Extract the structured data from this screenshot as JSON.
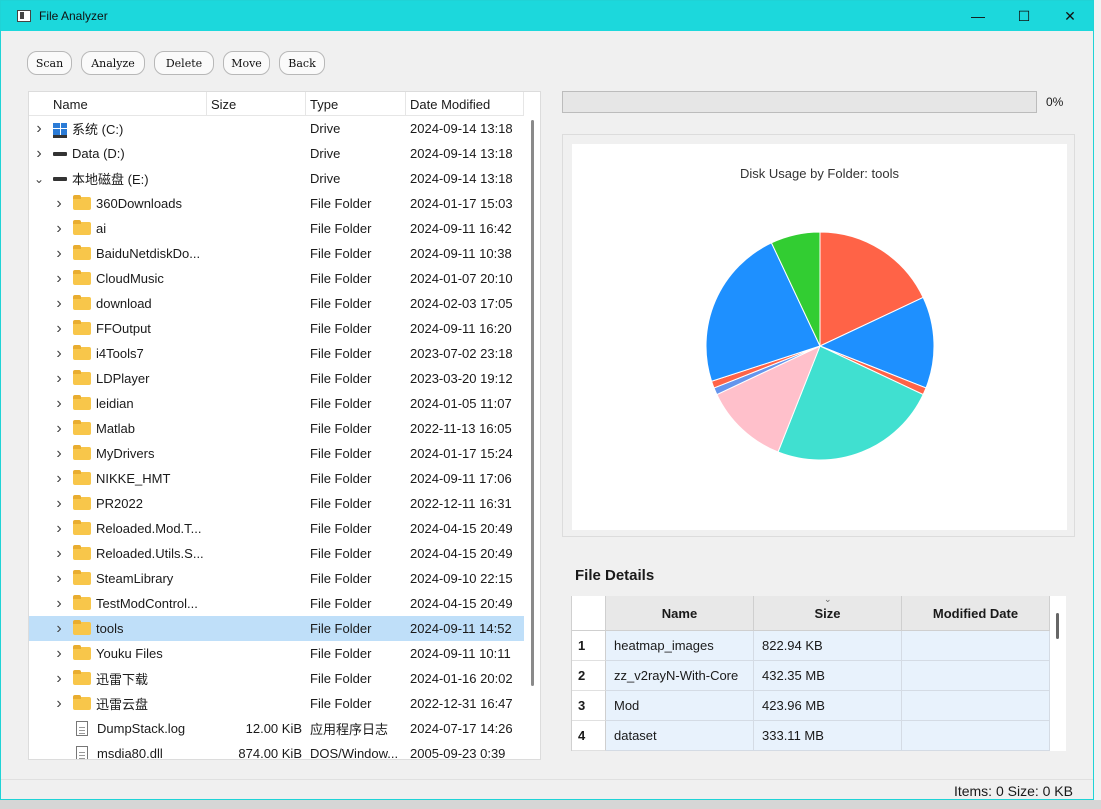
{
  "window": {
    "title": "File Analyzer",
    "minimize": "—",
    "maximize": "☐",
    "close": "✕"
  },
  "toolbar": {
    "scan": "Scan",
    "analyze": "Analyze",
    "delete": "Delete",
    "move": "Move",
    "back": "Back"
  },
  "tree": {
    "headers": {
      "name": "Name",
      "size": "Size",
      "type": "Type",
      "date": "Date Modified"
    },
    "rows": [
      {
        "level": 0,
        "expander": "closed",
        "icon": "system-drive-icon",
        "name": "系统 (C:)",
        "size": "",
        "type": "Drive",
        "date": "2024-09-14 13:18"
      },
      {
        "level": 0,
        "expander": "closed",
        "icon": "drive-icon",
        "name": "Data (D:)",
        "size": "",
        "type": "Drive",
        "date": "2024-09-14 13:18"
      },
      {
        "level": 0,
        "expander": "open",
        "icon": "drive-icon",
        "name": "本地磁盘 (E:)",
        "size": "",
        "type": "Drive",
        "date": "2024-09-14 13:18"
      },
      {
        "level": 1,
        "expander": "closed",
        "icon": "folder-icon",
        "name": "360Downloads",
        "size": "",
        "type": "File Folder",
        "date": "2024-01-17 15:03"
      },
      {
        "level": 1,
        "expander": "closed",
        "icon": "folder-icon",
        "name": "ai",
        "size": "",
        "type": "File Folder",
        "date": "2024-09-11 16:42"
      },
      {
        "level": 1,
        "expander": "closed",
        "icon": "folder-icon",
        "name": "BaiduNetdiskDo...",
        "size": "",
        "type": "File Folder",
        "date": "2024-09-11 10:38"
      },
      {
        "level": 1,
        "expander": "closed",
        "icon": "folder-icon",
        "name": "CloudMusic",
        "size": "",
        "type": "File Folder",
        "date": "2024-01-07 20:10"
      },
      {
        "level": 1,
        "expander": "closed",
        "icon": "folder-icon",
        "name": "download",
        "size": "",
        "type": "File Folder",
        "date": "2024-02-03 17:05"
      },
      {
        "level": 1,
        "expander": "closed",
        "icon": "folder-icon",
        "name": "FFOutput",
        "size": "",
        "type": "File Folder",
        "date": "2024-09-11 16:20"
      },
      {
        "level": 1,
        "expander": "closed",
        "icon": "folder-icon",
        "name": "i4Tools7",
        "size": "",
        "type": "File Folder",
        "date": "2023-07-02 23:18"
      },
      {
        "level": 1,
        "expander": "closed",
        "icon": "folder-icon",
        "name": "LDPlayer",
        "size": "",
        "type": "File Folder",
        "date": "2023-03-20 19:12"
      },
      {
        "level": 1,
        "expander": "closed",
        "icon": "folder-icon",
        "name": "leidian",
        "size": "",
        "type": "File Folder",
        "date": "2024-01-05 11:07"
      },
      {
        "level": 1,
        "expander": "closed",
        "icon": "folder-icon",
        "name": "Matlab",
        "size": "",
        "type": "File Folder",
        "date": "2022-11-13 16:05"
      },
      {
        "level": 1,
        "expander": "closed",
        "icon": "folder-icon",
        "name": "MyDrivers",
        "size": "",
        "type": "File Folder",
        "date": "2024-01-17 15:24"
      },
      {
        "level": 1,
        "expander": "closed",
        "icon": "folder-icon",
        "name": "NIKKE_HMT",
        "size": "",
        "type": "File Folder",
        "date": "2024-09-11 17:06"
      },
      {
        "level": 1,
        "expander": "closed",
        "icon": "folder-icon",
        "name": "PR2022",
        "size": "",
        "type": "File Folder",
        "date": "2022-12-11 16:31"
      },
      {
        "level": 1,
        "expander": "closed",
        "icon": "folder-icon",
        "name": "Reloaded.Mod.T...",
        "size": "",
        "type": "File Folder",
        "date": "2024-04-15 20:49"
      },
      {
        "level": 1,
        "expander": "closed",
        "icon": "folder-icon",
        "name": "Reloaded.Utils.S...",
        "size": "",
        "type": "File Folder",
        "date": "2024-04-15 20:49"
      },
      {
        "level": 1,
        "expander": "closed",
        "icon": "folder-icon",
        "name": "SteamLibrary",
        "size": "",
        "type": "File Folder",
        "date": "2024-09-10 22:15"
      },
      {
        "level": 1,
        "expander": "closed",
        "icon": "folder-icon",
        "name": "TestModControl...",
        "size": "",
        "type": "File Folder",
        "date": "2024-04-15 20:49"
      },
      {
        "level": 1,
        "expander": "closed",
        "icon": "folder-icon",
        "name": "tools",
        "size": "",
        "type": "File Folder",
        "date": "2024-09-11 14:52",
        "selected": true
      },
      {
        "level": 1,
        "expander": "closed",
        "icon": "folder-icon",
        "name": "Youku Files",
        "size": "",
        "type": "File Folder",
        "date": "2024-09-11 10:11"
      },
      {
        "level": 1,
        "expander": "closed",
        "icon": "folder-icon",
        "name": "迅雷下载",
        "size": "",
        "type": "File Folder",
        "date": "2024-01-16 20:02"
      },
      {
        "level": 1,
        "expander": "closed",
        "icon": "folder-icon",
        "name": "迅雷云盘",
        "size": "",
        "type": "File Folder",
        "date": "2022-12-31 16:47"
      },
      {
        "level": 1,
        "expander": "none",
        "icon": "file-icon",
        "name": "DumpStack.log",
        "size": "12.00 KiB",
        "type": "应用程序日志",
        "date": "2024-07-17 14:26"
      },
      {
        "level": 1,
        "expander": "none",
        "icon": "file-icon",
        "name": "msdia80.dll",
        "size": "874.00 KiB",
        "type": "DOS/Window...",
        "date": "2005-09-23 0:39"
      }
    ]
  },
  "progress": {
    "value": 0,
    "text": "0%"
  },
  "chart_data": {
    "type": "pie",
    "title": "Disk Usage by Folder: tools",
    "slices": [
      {
        "value": 18.0,
        "color": "#ff6347"
      },
      {
        "value": 13.0,
        "color": "#1e90ff"
      },
      {
        "value": 1.0,
        "color": "#ff6347"
      },
      {
        "value": 24.0,
        "color": "#40e0d0"
      },
      {
        "value": 12.0,
        "color": "#ffc0cb"
      },
      {
        "value": 1.0,
        "color": "#6495ed"
      },
      {
        "value": 1.0,
        "color": "#ff6347"
      },
      {
        "value": 23.0,
        "color": "#1e90ff"
      },
      {
        "value": 7.0,
        "color": "#32cd32"
      }
    ]
  },
  "details": {
    "title": "File Details",
    "columns": [
      "Name",
      "Size",
      "Modified Date"
    ],
    "rows": [
      {
        "n": "1",
        "name": "heatmap_images",
        "size": "822.94 KB",
        "date": ""
      },
      {
        "n": "2",
        "name": "zz_v2rayN-With-Core",
        "size": "432.35 MB",
        "date": ""
      },
      {
        "n": "3",
        "name": "Mod",
        "size": "423.96 MB",
        "date": ""
      },
      {
        "n": "4",
        "name": "dataset",
        "size": "333.11 MB",
        "date": ""
      }
    ]
  },
  "status": {
    "text": "Items: 0  Size: 0 KB"
  }
}
